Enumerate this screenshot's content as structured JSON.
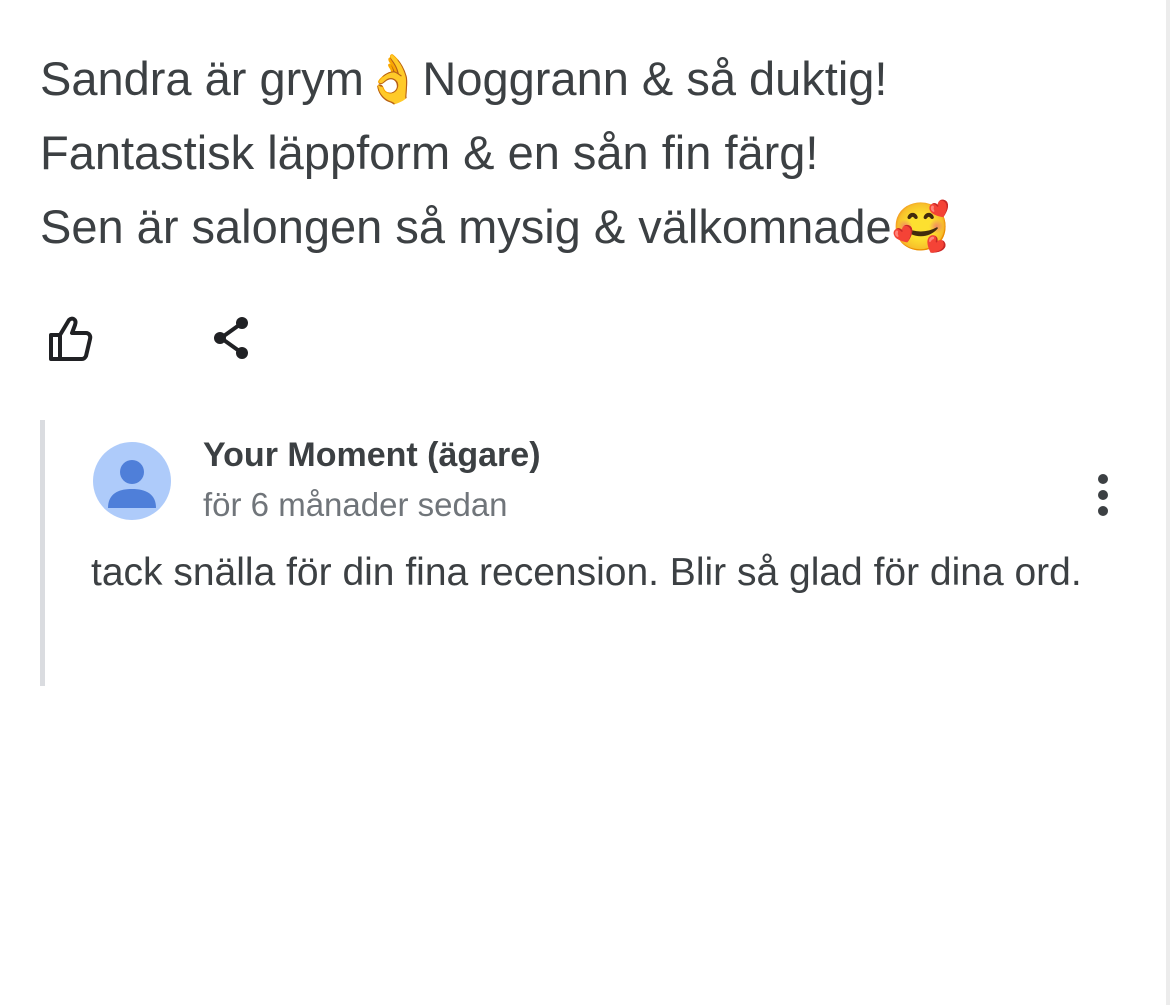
{
  "review": {
    "lines": [
      "Sandra är grym👌Noggrann & så duktig!",
      "Fantastisk läppform & en sån fin färg!",
      "Sen är salongen så mysig & välkomnade🥰"
    ]
  },
  "actions": {
    "like_icon": "thumbs-up-icon",
    "share_icon": "share-icon"
  },
  "reply": {
    "owner_name": "Your Moment (ägare)",
    "time": "för 6 månader sedan",
    "text": "tack snälla för din fina recension. Blir så glad för dina ord.",
    "avatar_icon": "person-icon",
    "menu_icon": "more-vert-icon"
  },
  "colors": {
    "text": "#3c4043",
    "secondary_text": "#70757a",
    "avatar_bg": "#aecbfa",
    "avatar_fg": "#4f7fd9",
    "reply_border": "#dadce0"
  }
}
